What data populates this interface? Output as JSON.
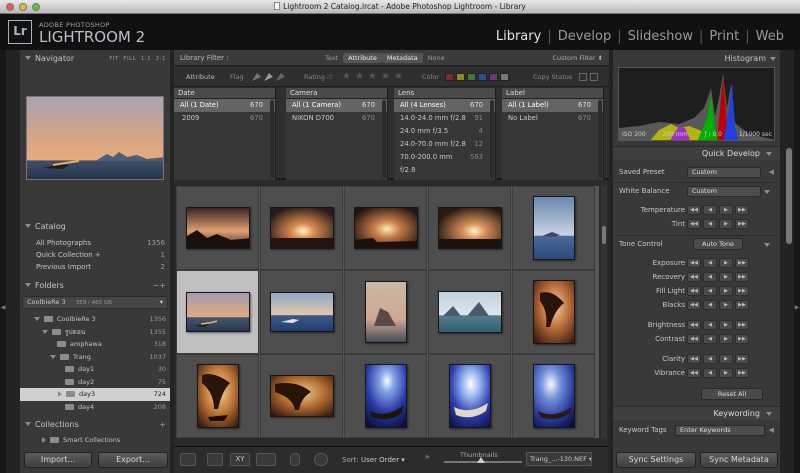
{
  "window": {
    "title": "Lightroom 2 Catalog.lrcat - Adobe Photoshop Lightroom - Library"
  },
  "brand": {
    "logo": "Lr",
    "sub": "ADOBE PHOTOSHOP",
    "main": "LIGHTROOM 2"
  },
  "modules": [
    "Library",
    "Develop",
    "Slideshow",
    "Print",
    "Web"
  ],
  "module_separator": "|",
  "left": {
    "navigator": {
      "title": "Navigator",
      "zoom": [
        "FIT",
        "FILL",
        "1:1",
        "2:1"
      ]
    },
    "catalog": {
      "title": "Catalog",
      "items": [
        {
          "label": "All Photographs",
          "count": "1356"
        },
        {
          "label": "Quick Collection +",
          "count": "1"
        },
        {
          "label": "Previous Import",
          "count": "2"
        }
      ]
    },
    "folders": {
      "title": "Folders",
      "volume": {
        "name": "CoolbieRe 3",
        "size": "359 / 465 GB"
      },
      "items": [
        {
          "name": "CoolbieRe 3",
          "count": "1356"
        },
        {
          "name": "รูปตอน",
          "count": "1355"
        },
        {
          "name": "amphawa",
          "count": "318"
        },
        {
          "name": "Trang",
          "count": "1037"
        },
        {
          "name": "day1",
          "count": "30"
        },
        {
          "name": "day2",
          "count": "75"
        },
        {
          "name": "day3",
          "count": "724"
        },
        {
          "name": "day4",
          "count": "208"
        }
      ]
    },
    "collections": {
      "title": "Collections",
      "items": [
        {
          "label": "Smart Collections"
        }
      ]
    },
    "import_label": "Import...",
    "export_label": "Export..."
  },
  "filter": {
    "title": "Library Filter :",
    "tabs": [
      "Text",
      "Attribute",
      "Metadata",
      "None"
    ],
    "custom": "Custom Filter ⬍"
  },
  "attr": {
    "attribute": "Attribute",
    "flag": "Flag",
    "rating": "Rating",
    "color": "Color",
    "copy": "Copy Status"
  },
  "color_swatches": [
    "#7a2c2c",
    "#8a8a2a",
    "#3a7a3a",
    "#2f4f8a",
    "#6a3a7a",
    "#777777"
  ],
  "meta": [
    {
      "header": "Date",
      "rows": [
        [
          "All (1 Date)",
          "670"
        ],
        [
          "2009",
          "670"
        ]
      ]
    },
    {
      "header": "Camera",
      "rows": [
        [
          "All (1 Camera)",
          "670"
        ],
        [
          "NIKON D700",
          "670"
        ]
      ]
    },
    {
      "header": "Lens",
      "rows": [
        [
          "All (4 Lenses)",
          "670"
        ],
        [
          "14.0-24.0 mm f/2.8",
          "91"
        ],
        [
          "24.0 mm f/3.5",
          "4"
        ],
        [
          "24.0-70.0 mm f/2.8",
          "12"
        ],
        [
          "70.0-200.0 mm f/2.8",
          "563"
        ]
      ]
    },
    {
      "header": "Label",
      "rows": [
        [
          "All (1 Label)",
          "670"
        ],
        [
          "No Label",
          "670"
        ]
      ]
    }
  ],
  "toolbar": {
    "sort_label": "Sort:",
    "sort_value": "User Order ▾",
    "thumbs_label": "Thumbnails",
    "filename": "Trang_...-130.NEF ▾"
  },
  "right": {
    "histogram": {
      "title": "Histogram",
      "iso": "ISO 200",
      "focal": "200 mm",
      "aperture": "ƒ / 8.0",
      "shutter": "1/1000 sec"
    },
    "quick_develop": {
      "title": "Quick Develop",
      "saved_preset": {
        "label": "Saved Preset",
        "value": "Custom"
      },
      "white_balance": {
        "label": "White Balance",
        "value": "Custom"
      },
      "temperature": "Temperature",
      "tint": "Tint",
      "tone_control": "Tone Control",
      "auto_tone": "Auto Tone",
      "tone_items": [
        "Exposure",
        "Recovery",
        "Fill Light",
        "Blacks",
        "Brightness",
        "Contrast",
        "Clarity",
        "Vibrance"
      ],
      "reset": "Reset All"
    },
    "keywording": {
      "title": "Keywording",
      "tags_label": "Keyword Tags",
      "tags_value": "Enter Keywords"
    },
    "sync_settings": "Sync Settings",
    "sync_metadata": "Sync Metadata"
  },
  "step_glyphs": [
    "◀◀",
    "◀",
    "▶",
    "▶▶"
  ],
  "icons": [
    "close-icon",
    "minimize-icon",
    "zoom-icon",
    "grid-view-icon",
    "loupe-view-icon",
    "compare-view-icon",
    "survey-view-icon",
    "spray-can-icon",
    "flag-icon",
    "rotate-icon"
  ]
}
